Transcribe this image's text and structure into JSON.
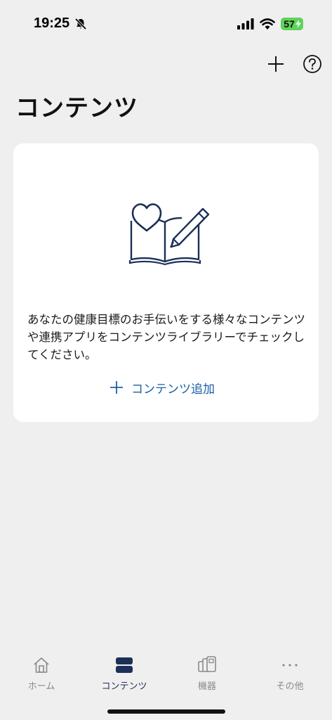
{
  "status_bar": {
    "time": "19:25",
    "battery": "57"
  },
  "header": {
    "title": "コンテンツ",
    "add_icon": "plus-icon",
    "help_icon": "question-circle-icon"
  },
  "card": {
    "illustration": "heart-book-pen-icon",
    "description": "あなたの健康目標のお手伝いをする様々なコンテンツや連携アプリをコンテンツライブラリーでチェックしてください。",
    "add_label": "コンテンツ追加",
    "accent_color": "#1d5ea8"
  },
  "tabs": [
    {
      "label": "ホーム",
      "icon": "home-icon",
      "active": false
    },
    {
      "label": "コンテンツ",
      "icon": "content-icon",
      "active": true
    },
    {
      "label": "機器",
      "icon": "devices-icon",
      "active": false
    },
    {
      "label": "その他",
      "icon": "more-icon",
      "active": false
    }
  ],
  "colors": {
    "background": "#efefef",
    "active_tab": "#1b2f57",
    "inactive_tab": "#8a8a8a",
    "battery": "#5ed35a"
  }
}
